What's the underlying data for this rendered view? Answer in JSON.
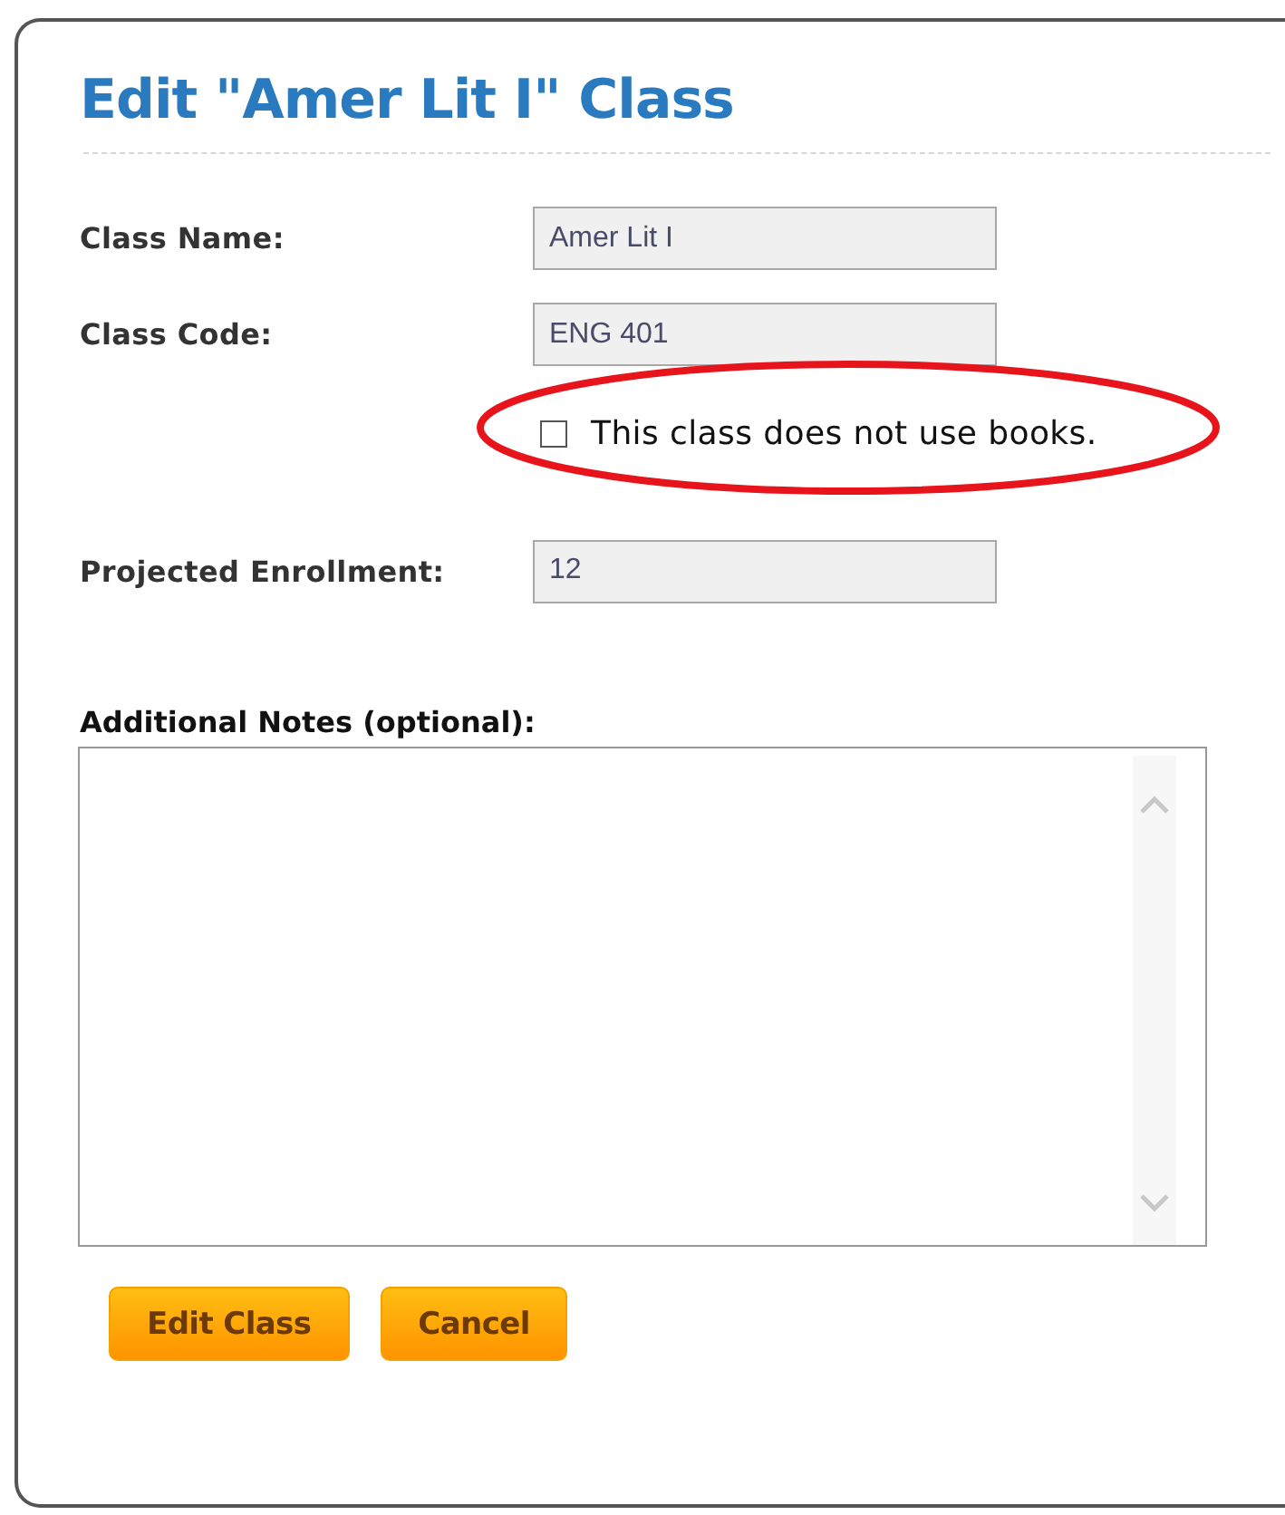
{
  "dialog": {
    "title": "Edit \"Amer Lit I\" Class"
  },
  "fields": [
    {
      "kind": "text",
      "label": "Class Name:",
      "value": "Amer Lit I"
    },
    {
      "kind": "text",
      "label": "Class Code:",
      "value": "ENG 401"
    },
    {
      "kind": "checkbox",
      "label": "This class does not use books.",
      "checked": false,
      "highlighted": true
    },
    {
      "kind": "text",
      "label": "Projected Enrollment:",
      "value": "12"
    }
  ],
  "notes": {
    "label": "Additional Notes (optional):"
  },
  "buttons": [
    "Edit Class",
    "Cancel"
  ]
}
